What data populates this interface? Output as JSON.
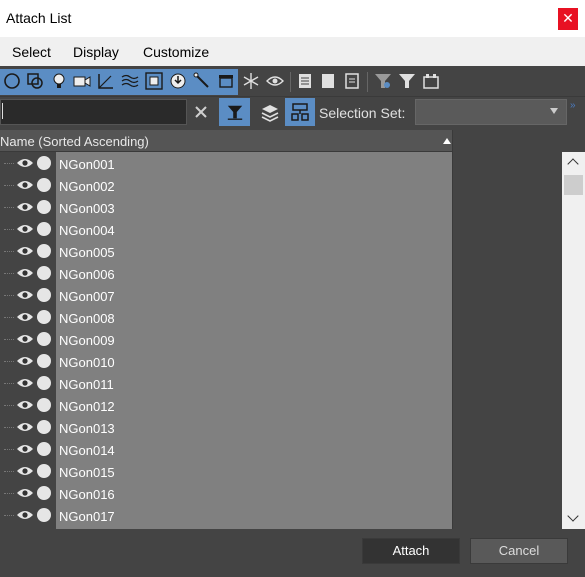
{
  "window": {
    "title": "Attach List",
    "close_label": "✕"
  },
  "menu": {
    "items": [
      "Select",
      "Display",
      "Customize"
    ]
  },
  "toolbar": {
    "selected_group_icons": [
      "geometry-filter-icon",
      "shapes-filter-icon",
      "lights-filter-icon",
      "cameras-filter-icon",
      "helpers-filter-icon",
      "space-warps-filter-icon",
      "groups-filter-icon",
      "xrefs-filter-icon",
      "bones-filter-icon",
      "containers-filter-icon"
    ],
    "other_icons": [
      "frozen-filter-icon",
      "hidden-filter-icon",
      "display-all-icon",
      "display-none-icon",
      "invert-display-icon",
      "filter-options-icon",
      "filter-icon",
      "containers-toggle-icon"
    ]
  },
  "search": {
    "value": "",
    "placeholder": "",
    "selection_set_label": "Selection Set:",
    "selection_set_value": "",
    "more_label": "»"
  },
  "list": {
    "header": "Name (Sorted Ascending)",
    "items": [
      "NGon001",
      "NGon002",
      "NGon003",
      "NGon004",
      "NGon005",
      "NGon006",
      "NGon007",
      "NGon008",
      "NGon009",
      "NGon010",
      "NGon011",
      "NGon012",
      "NGon013",
      "NGon014",
      "NGon015",
      "NGon016",
      "NGon017"
    ]
  },
  "footer": {
    "attach_label": "Attach",
    "cancel_label": "Cancel"
  },
  "colors": {
    "accent": "#5b8dc4",
    "selection": "#808080",
    "panel": "#444444"
  }
}
